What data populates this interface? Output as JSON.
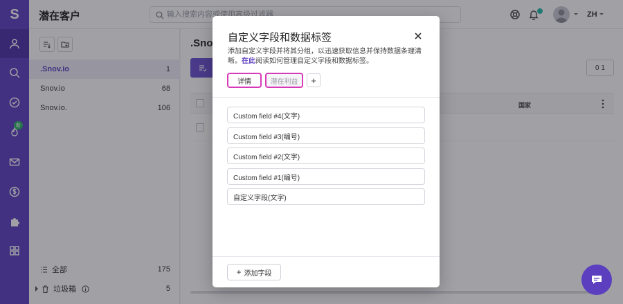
{
  "app": {
    "logo": "S",
    "page_title": "潜在客户"
  },
  "search": {
    "placeholder": "输入搜索内容或使用高级过滤器",
    "value": ""
  },
  "user": {
    "lang": "ZH"
  },
  "rail": {
    "new_badge": "新"
  },
  "lists": {
    "items": [
      {
        "name": ".Snov.io",
        "count": "1",
        "active": true
      },
      {
        "name": "Snov.io",
        "count": "68",
        "active": false
      },
      {
        "name": "Snov.io.",
        "count": "106",
        "active": false
      }
    ],
    "all_label": "全部",
    "all_count": "175",
    "trash_label": "垃圾箱",
    "trash_count": "5"
  },
  "main": {
    "title": ".Snov",
    "right_pill": "0 1",
    "country_header": "国家"
  },
  "modal": {
    "title": "自定义字段和数据标签",
    "desc": "添加自定义字段并将其分组，以迅速获取信息并保持数据条理清晰。",
    "desc_link_1": "在此",
    "desc_rest": "阅读如何管理自定义字段和数据标签。",
    "tabs": {
      "details": "详情",
      "profit": "潜在利益",
      "add": "+"
    },
    "fields": [
      "Custom field #4(文字)",
      "Custom field #3(编号)",
      "Custom field #2(文字)",
      "Custom field #1(编号)",
      "自定义字段(文字)"
    ],
    "add_field_plus": "+",
    "add_field_label": "添加字段"
  },
  "colors": {
    "brand": "#5b3fbf",
    "tab_highlight": "#d63ab8",
    "badge_green": "#28b463"
  }
}
